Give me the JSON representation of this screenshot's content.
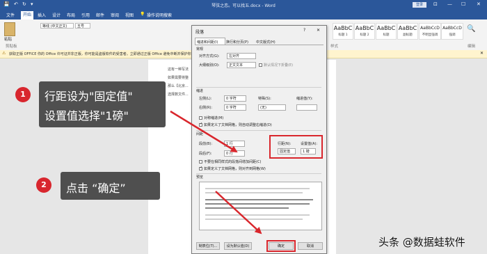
{
  "window": {
    "title": "琴弦之恋。可以找五.docx - Word",
    "login": "登录",
    "min": "—",
    "max": "☐",
    "close": "✕",
    "ribbon_options": "⊡"
  },
  "quick_access": {
    "save": "💾",
    "undo": "↶",
    "redo": "↻",
    "more": "▾"
  },
  "tabs": [
    "文件",
    "开始",
    "插入",
    "设计",
    "布局",
    "引用",
    "邮件",
    "审阅",
    "视图",
    "操作说明搜索"
  ],
  "ribbon": {
    "font_name": "等线 (中文正文)",
    "font_size": "五号",
    "clipboard_label": "剪贴板",
    "paste_label": "粘贴",
    "styles_label": "样式",
    "editing_label": "编辑",
    "styles": [
      {
        "sample": "AaBbC",
        "name": "标题 1"
      },
      {
        "sample": "AaBbC",
        "name": "标题 2"
      },
      {
        "sample": "AaBbC",
        "name": "标题"
      },
      {
        "sample": "AaBbC",
        "name": "副标题"
      },
      {
        "sample": "AaBbCcD",
        "name": "不明显强调"
      },
      {
        "sample": "AaBbCcD",
        "name": "强调"
      }
    ]
  },
  "warning": {
    "text": "获取正版 OFFICE  你的 Office 许可证并非正版，你可能是盗版软件的受害者。立即通过正版 Office 避免中断并保护你的文件安全。",
    "close": "✕"
  },
  "document": {
    "lines": [
      "这有一种写法",
      "如果需要将整",
      "那么【北京...",
      "选择数文件..."
    ]
  },
  "dialog": {
    "title": "段落",
    "help": "?",
    "close": "✕",
    "tabs": [
      "缩进和间距(I)",
      "换行和分页(P)",
      "中文版式(H)"
    ],
    "general_label": "常规",
    "alignment_label": "对齐方式(G):",
    "alignment_value": "左对齐",
    "outline_label": "大纲级别(O):",
    "outline_value": "正文文本",
    "collapsed_label": "默认情况下折叠(E)",
    "indent_label": "缩进",
    "left_label": "左侧(L):",
    "left_value": "0 字符",
    "right_label": "右侧(R):",
    "right_value": "0 字符",
    "special_label": "特殊(S):",
    "special_value": "(无)",
    "indent_by_label": "缩进值(Y):",
    "mirror_label": "对称缩进(M)",
    "auto_adjust_label": "如果定义了文档网格，则自动调整右缩进(D)",
    "spacing_label": "间距",
    "before_label": "段前(B):",
    "before_value": "1 行",
    "after_label": "段后(F):",
    "after_value": "0 行",
    "line_spacing_label": "行距(N):",
    "line_spacing_value": "固定值",
    "at_label": "设置值(A):",
    "at_value": "1 磅",
    "no_space_label": "不要在相同样式的段落间增加间距(C)",
    "snap_grid_label": "如果定义了文档网格，则对齐到网格(W)",
    "preview_label": "预览",
    "tabs_button": "制表位(T)...",
    "default_button": "设为默认值(D)",
    "ok_button": "确定",
    "cancel_button": "取消"
  },
  "callouts": {
    "step1_number": "1",
    "step1_line1": "行距设为\"固定值\"",
    "step1_line2": "设置值选择\"1磅\"",
    "step2_number": "2",
    "step2_text": "点击 “确定”"
  },
  "watermark": "头条 @数据蛙软件",
  "colors": {
    "word_blue": "#2b579a",
    "highlight_red": "#d9262c",
    "callout_bg": "#4f4f4f"
  }
}
